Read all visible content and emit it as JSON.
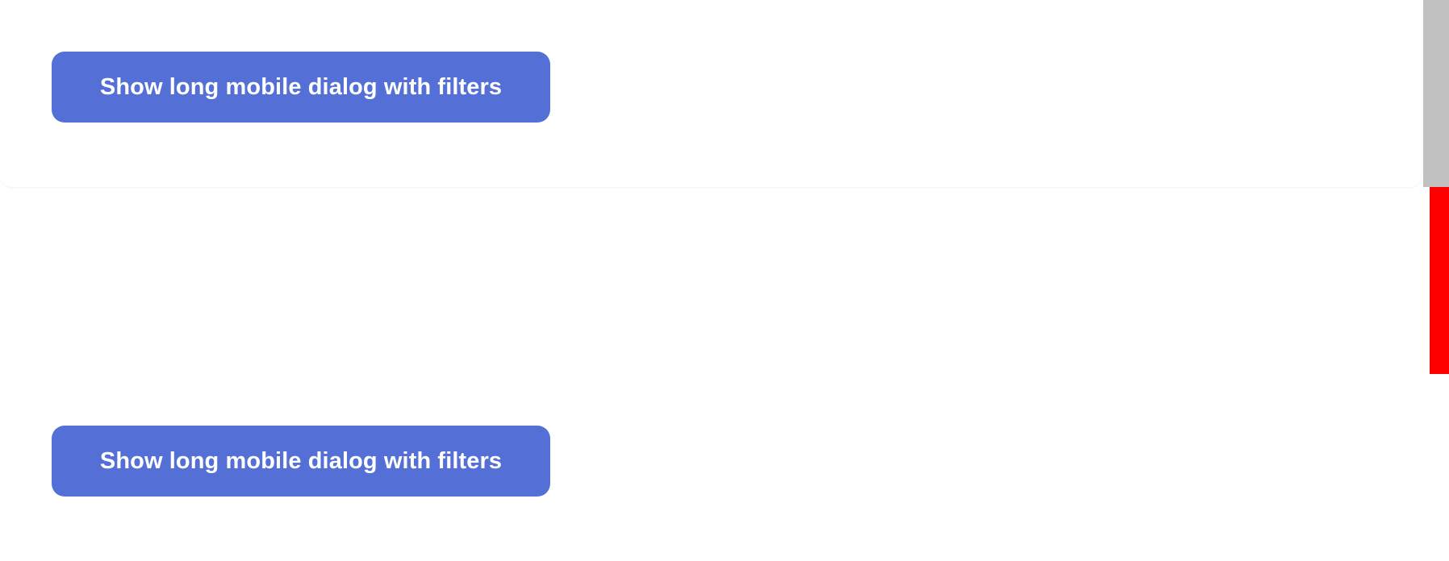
{
  "top_panel": {
    "button_label": "Show long mobile dialog with filters"
  },
  "bottom_panel": {
    "button_label": "Show long mobile dialog with filters"
  },
  "colors": {
    "button_background": "#5470d6",
    "button_text": "#ffffff",
    "scrollbar": "#c1c1c1",
    "marker": "#ff0000"
  }
}
